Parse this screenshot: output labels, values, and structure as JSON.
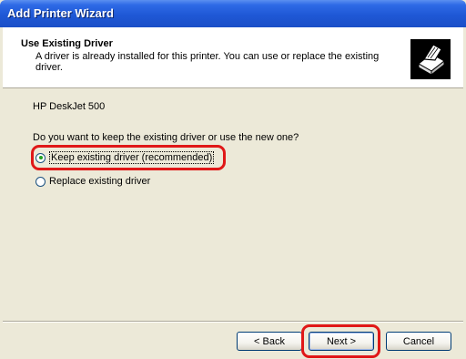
{
  "window": {
    "title": "Add Printer Wizard"
  },
  "header": {
    "title": "Use Existing Driver",
    "subtitle": "A driver is already installed for this printer. You can use or replace the existing driver."
  },
  "body": {
    "printer_model": "HP DeskJet 500",
    "question": "Do you want to keep the existing driver or use the new one?",
    "options": [
      {
        "label": "Keep existing driver (recommended)",
        "selected": true
      },
      {
        "label": "Replace existing driver",
        "selected": false
      }
    ]
  },
  "buttons": {
    "back_label": "< Back",
    "next_label": "Next >",
    "cancel_label": "Cancel"
  },
  "colors": {
    "annotation_highlight": "#e01818",
    "title_bar": "#1f58d6"
  }
}
